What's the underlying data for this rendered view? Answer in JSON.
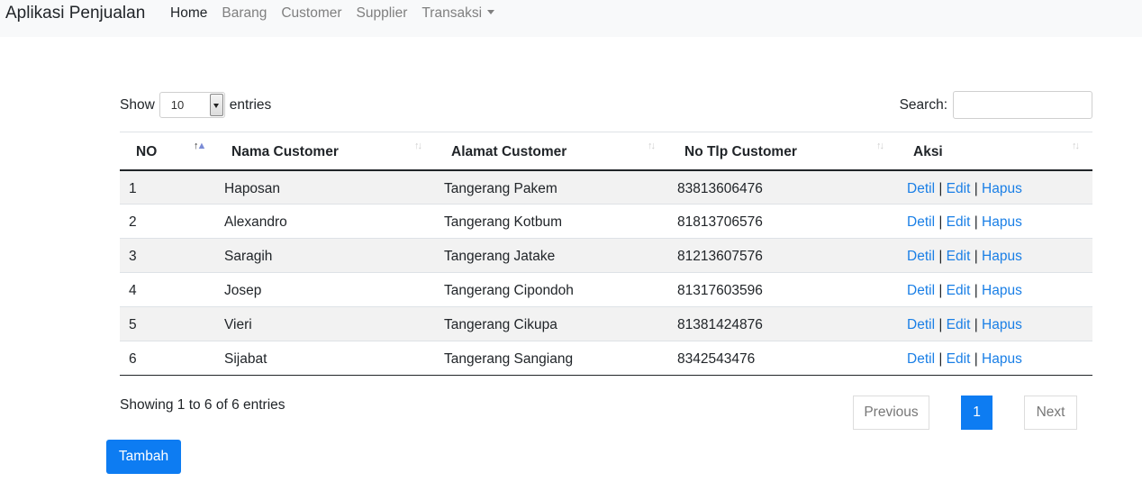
{
  "navbar": {
    "brand": "Aplikasi Penjualan",
    "items": [
      {
        "label": "Home"
      },
      {
        "label": "Barang"
      },
      {
        "label": "Customer"
      },
      {
        "label": "Supplier"
      },
      {
        "label": "Transaksi"
      }
    ]
  },
  "length": {
    "show_label": "Show",
    "value": "10",
    "entries_label": "entries"
  },
  "search": {
    "label": "Search:",
    "value": ""
  },
  "table": {
    "headers": [
      "NO",
      "Nama Customer",
      "Alamat Customer",
      "No Tlp Customer",
      "Aksi"
    ],
    "rows": [
      {
        "no": "1",
        "nama": "Haposan",
        "alamat": "Tangerang Pakem",
        "tlp": "83813606476"
      },
      {
        "no": "2",
        "nama": "Alexandro",
        "alamat": "Tangerang Kotbum",
        "tlp": "81813706576"
      },
      {
        "no": "3",
        "nama": "Saragih",
        "alamat": "Tangerang Jatake",
        "tlp": "81213607576"
      },
      {
        "no": "4",
        "nama": "Josep",
        "alamat": "Tangerang Cipondoh",
        "tlp": "81317603596"
      },
      {
        "no": "5",
        "nama": "Vieri",
        "alamat": "Tangerang Cikupa",
        "tlp": "81381424876"
      },
      {
        "no": "6",
        "nama": "Sijabat",
        "alamat": "Tangerang Sangiang",
        "tlp": "8342543476"
      }
    ],
    "actions": {
      "detil": "Detil",
      "edit": "Edit",
      "hapus": "Hapus",
      "separator": "|"
    }
  },
  "info": "Showing 1 to 6 of 6 entries",
  "pagination": {
    "previous": "Previous",
    "current": "1",
    "next": "Next"
  },
  "add_button": "Tambah",
  "colors": {
    "accent": "#0d7cf2",
    "link": "#1a7fe6",
    "navbar_bg": "#f8f9fa",
    "stripe": "#f2f2f2"
  }
}
